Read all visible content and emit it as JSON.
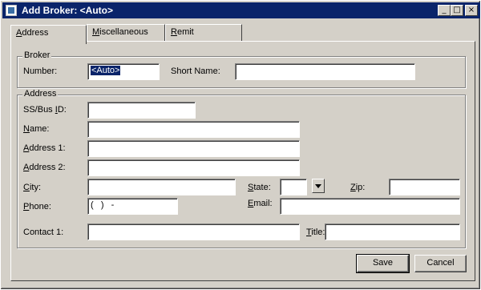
{
  "window": {
    "title": "Add Broker: <Auto>",
    "minimize_glyph": "_",
    "maximize_glyph": "□",
    "close_glyph": "×"
  },
  "tabs": [
    {
      "label": "Address",
      "accel": "A",
      "rest": "ddress"
    },
    {
      "label": "Miscellaneous",
      "accel": "M",
      "rest": "iscellaneous"
    },
    {
      "label": "Remit",
      "accel": "R",
      "rest": "emit"
    }
  ],
  "broker_group": {
    "title": "Broker",
    "number_label": "Number:",
    "number_value": "<Auto>",
    "short_name_label": "Short Name:",
    "short_name_value": ""
  },
  "address_group": {
    "title": "Address",
    "ssbus": {
      "pre": "SS/Bus ",
      "accel": "I",
      "post": "D:",
      "value": ""
    },
    "name": {
      "accel": "N",
      "post": "ame:",
      "value": ""
    },
    "address1": {
      "accel": "A",
      "post": "ddress 1:",
      "value": ""
    },
    "address2": {
      "accel": "A",
      "post": "ddress 2:",
      "value": ""
    },
    "city": {
      "accel": "C",
      "post": "ity:",
      "value": ""
    },
    "state": {
      "accel": "S",
      "post": "tate:",
      "value": ""
    },
    "zip": {
      "accel": "Z",
      "post": "ip:",
      "value": ""
    },
    "phone": {
      "accel": "P",
      "post": "hone:",
      "value": "(   )   -"
    },
    "email": {
      "accel": "E",
      "post": "mail:",
      "value": ""
    },
    "contact1": {
      "label": "Contact 1:",
      "value": ""
    },
    "title_field": {
      "accel": "T",
      "post": "itle:",
      "value": ""
    }
  },
  "buttons": {
    "save": "Save",
    "cancel": "Cancel"
  }
}
